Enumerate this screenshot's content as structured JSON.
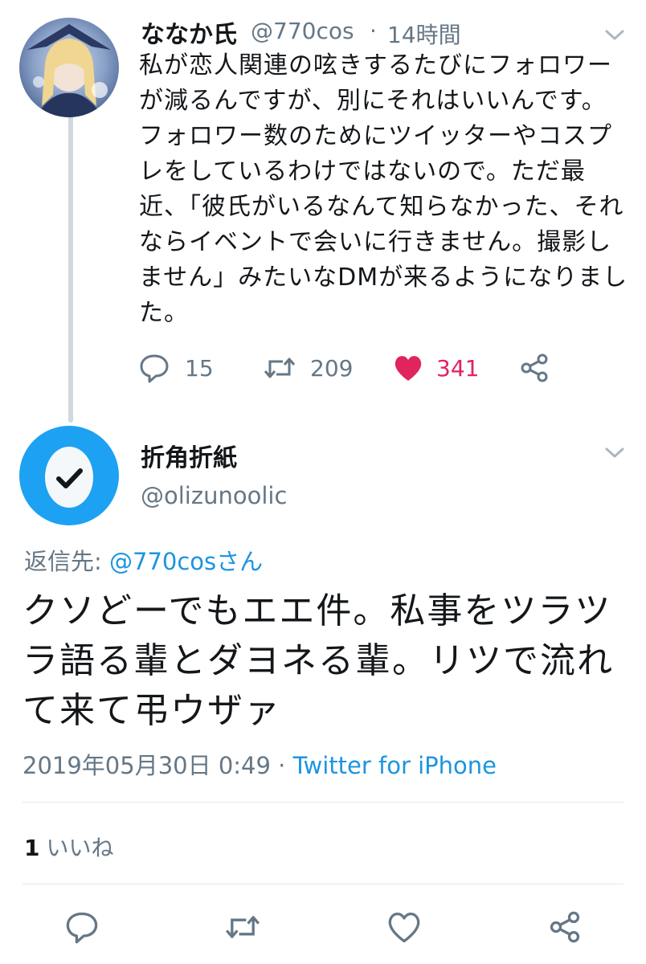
{
  "parent_tweet": {
    "display_name": "ななか氏",
    "handle": "@770cos",
    "separator": "·",
    "time": "14時間",
    "text": "私が恋人関連の呟きするたびにフォロワーが減るんですが、別にそれはいいんです。フォロワー数のためにツイッターやコスプレをしているわけではないので。ただ最近、「彼氏がいるなんて知らなかった、それならイベントで会いに行きません。撮影しません」みたいなDMが来るようになりました。",
    "replies": "15",
    "retweets": "209",
    "likes": "341",
    "liked": true
  },
  "reply_tweet": {
    "display_name": "折角折紙",
    "handle": "@olizunoolic",
    "reply_prefix": "返信先: ",
    "reply_to": "@770cosさん",
    "text": "クソどーでもエエ件。私事をツラツラ語る輩とダヨネる輩。リツで流れて来て弔ウザァ",
    "timestamp": "2019年05月30日 0:49",
    "separator": " · ",
    "source": "Twitter for iPhone",
    "like_count": "1",
    "like_label": "いいね"
  },
  "icons": {
    "menu": "chevron-down-icon",
    "reply": "reply-icon",
    "retweet": "retweet-icon",
    "like": "heart-icon",
    "share": "share-icon",
    "default_avatar": "egg-avatar-icon"
  },
  "colors": {
    "accent": "#1da1f2",
    "link": "#1b95e0",
    "like": "#e0245e",
    "secondary_text": "#657786",
    "divider": "#e1e8ed"
  }
}
